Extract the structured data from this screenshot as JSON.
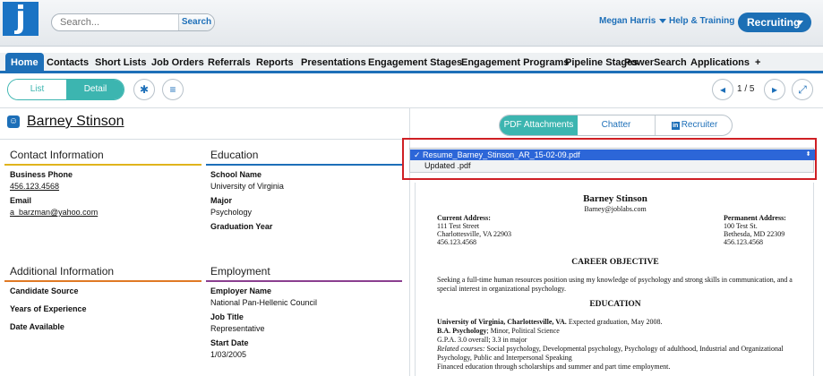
{
  "header": {
    "logo_letter": "j",
    "search": {
      "placeholder": "Search...",
      "button_label": "Search"
    },
    "user_name": "Megan Harris",
    "help_label": "Help & Training",
    "mode_label": "Recruiting"
  },
  "nav": {
    "items": [
      "Home",
      "Contacts",
      "Short Lists",
      "Job Orders",
      "Referrals",
      "Reports",
      "Presentations",
      "Engagement Stages",
      "Engagement Programs",
      "Pipeline Stages",
      "PowerSearch",
      "Applications",
      "+"
    ],
    "active": "Home"
  },
  "toolbar": {
    "list_label": "List",
    "detail_label": "Detail",
    "pager": "1 / 5"
  },
  "candidate": {
    "name": "Barney Stinson"
  },
  "sections": {
    "contact": {
      "title": "Contact Information",
      "color": "#e0b41c",
      "phone_label": "Business Phone",
      "phone": "456.123.4568",
      "email_label": "Email",
      "email": "a_barzman@yahoo.com"
    },
    "education": {
      "title": "Education",
      "color": "#1d6fb8",
      "school_label": "School Name",
      "school": "University of Virginia",
      "major_label": "Major",
      "major": "Psychology",
      "grad_label": "Graduation Year"
    },
    "additional": {
      "title": "Additional Information",
      "color": "#e07a24",
      "source_label": "Candidate Source",
      "years_label": "Years of Experience",
      "available_label": "Date Available"
    },
    "employment": {
      "title": "Employment",
      "color": "#8a3f8f",
      "employer_label": "Employer Name",
      "employer": "National Pan-Hellenic Council",
      "job_title_label": "Job Title",
      "job_title": "Representative",
      "start_label": "Start Date",
      "start": "1/03/2005"
    }
  },
  "right_tabs": {
    "pdf": "PDF Attachments",
    "chatter": "Chatter",
    "recruiter": "Recruiter",
    "recruiter_badge": "in"
  },
  "attachments": {
    "selected": "Resume_Barney_Stinson_AR_15-02-09.pdf",
    "other": "Updated .pdf"
  },
  "resume": {
    "name": "Barney Stinson",
    "email": "Barney@joblabs.com",
    "current_label": "Current Address:",
    "current_street": "111 Test Street",
    "current_city": "Charlottesville, VA  22903",
    "current_phone": "456.123.4568",
    "perm_label": "Permanent Address:",
    "perm_street": "100 Test St.",
    "perm_city": "Bethesda, MD 22309",
    "perm_phone": "456.123.4568",
    "objective_title": "CAREER OBJECTIVE",
    "objective_1": "Seeking a full-time human resources position using my knowledge of psychology and strong skills in communication, and a",
    "objective_2": "special interest in organizational psychology.",
    "education_title": "EDUCATION",
    "edu_school": "University of Virginia, Charlottesville, VA.",
    "edu_grad": " Expected graduation, May 2008.",
    "edu_degree": "B.A. Psychology",
    "edu_minor": "; Minor, Political Science",
    "edu_gpa": "G.P.A. 3.0 overall; 3.3 in major",
    "edu_courses_label": "Related courses:",
    "edu_courses_1": " Social psychology, Developmental psychology, Psychology of adulthood, Industrial and Organizational",
    "edu_courses_2": "Psychology, Public and Interpersonal Speaking",
    "edu_financed": "Financed education through scholarships and summer and part time employment."
  }
}
